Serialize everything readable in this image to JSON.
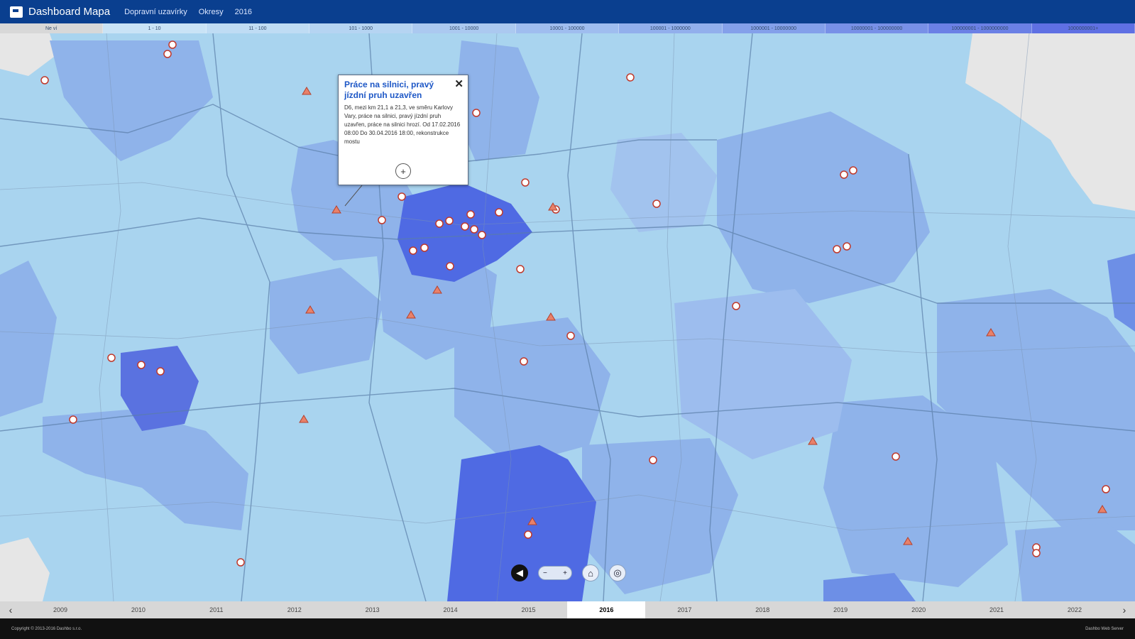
{
  "header": {
    "title": "Dashboard Mapa",
    "nav": [
      "Dopravní uzavírky",
      "Okresy",
      "2016"
    ]
  },
  "legend": {
    "ranges": [
      "Ne ví",
      "1 - 10",
      "11 - 100",
      "101 - 1000",
      "1001 - 10000",
      "10001 - 100000",
      "100001 - 1000000",
      "1000001 - 10000000",
      "10000001 - 100000000",
      "100000001 - 1000000000",
      "1000000001+"
    ]
  },
  "popup": {
    "title": "Práce na silnici, pravý jízdní pruh uzavřen",
    "body": "D6, mezi km 21,1 a 21,3, ve směru Karlovy Vary, práce na silnici, pravý jízdní pruh uzavřen, práce na silnici hrozí. Od 17.02.2016 08:00 Do 30.04.2016 18:00, rekonstrukce mostu",
    "close": "✕",
    "more": "+"
  },
  "controls": {
    "prev_icon": "◀",
    "zoom_minus": "−",
    "zoom_plus": "+",
    "home_icon": "⌂",
    "target_icon": "◎"
  },
  "timeline": {
    "prev": "‹",
    "next": "›",
    "years": [
      "2009",
      "2010",
      "2011",
      "2012",
      "2013",
      "2014",
      "2015",
      "2016",
      "2017",
      "2018",
      "2019",
      "2020",
      "2021",
      "2022"
    ],
    "active": "2016"
  },
  "footer": {
    "left": "Copyright © 2013-2016 Dashbo s.r.o.",
    "right": "Dashbo Web Server"
  },
  "colors": {
    "level1": "#a9d4ef",
    "level2": "#8fb3ea",
    "level3": "#6d8fe6",
    "level4": "#4f6ae3",
    "gray": "#e6e6e6"
  }
}
